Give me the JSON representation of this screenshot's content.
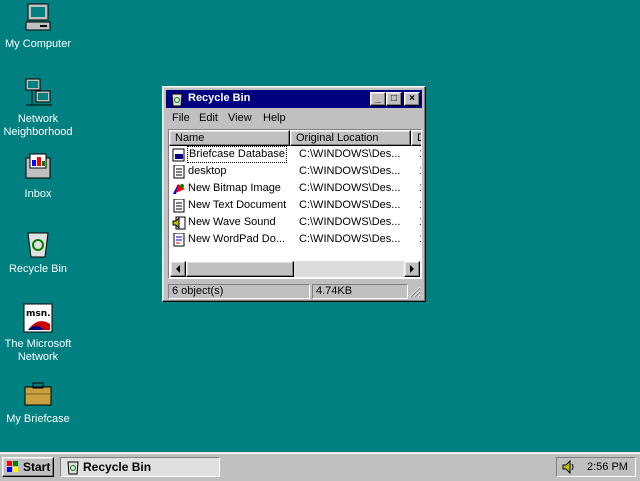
{
  "desktop": {
    "icons": [
      {
        "label_line1": "My Computer",
        "label_line2": ""
      },
      {
        "label_line1": "Network",
        "label_line2": "Neighborhood"
      },
      {
        "label_line1": "Inbox",
        "label_line2": ""
      },
      {
        "label_line1": "Recycle Bin",
        "label_line2": ""
      },
      {
        "label_line1": "The Microsoft",
        "label_line2": "Network"
      },
      {
        "label_line1": "My Briefcase",
        "label_line2": ""
      }
    ]
  },
  "window": {
    "title": "Recycle Bin",
    "controls": {
      "minimize": "_",
      "maximize": "□",
      "close": "×"
    },
    "menu": [
      "File",
      "Edit",
      "View",
      "Help"
    ],
    "columns": [
      "Name",
      "Original Location",
      "D"
    ],
    "rows": [
      {
        "name": "Briefcase Database",
        "location": "C:\\WINDOWS\\Des...",
        "d": "1",
        "icon": "briefcase-db-icon"
      },
      {
        "name": "desktop",
        "location": "C:\\WINDOWS\\Des...",
        "d": "1",
        "icon": "text-file-icon"
      },
      {
        "name": "New Bitmap Image",
        "location": "C:\\WINDOWS\\Des...",
        "d": "1",
        "icon": "paint-icon"
      },
      {
        "name": "New Text Document",
        "location": "C:\\WINDOWS\\Des...",
        "d": "1",
        "icon": "text-file-icon"
      },
      {
        "name": "New Wave Sound",
        "location": "C:\\WINDOWS\\Des...",
        "d": "1",
        "icon": "sound-icon"
      },
      {
        "name": "New WordPad Do...",
        "location": "C:\\WINDOWS\\Des...",
        "d": "1",
        "icon": "wordpad-icon"
      }
    ],
    "status": {
      "count": "6 object(s)",
      "size": "4.74KB"
    }
  },
  "taskbar": {
    "start_label": "Start",
    "task_label": "Recycle Bin",
    "clock": "2:56 PM"
  },
  "colors": {
    "desktop": "#008080",
    "titlebar": "#000080",
    "face": "#c0c0c0"
  }
}
